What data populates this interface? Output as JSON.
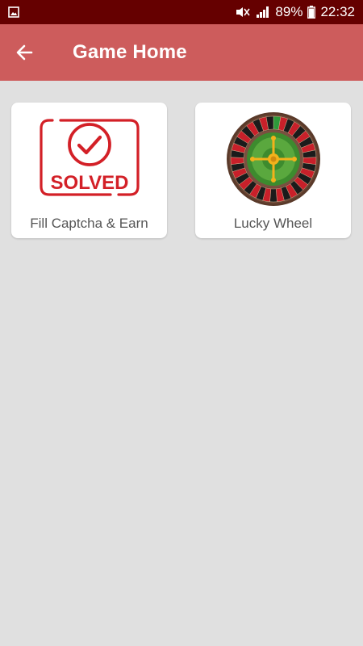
{
  "status_bar": {
    "battery": "89%",
    "time": "22:32",
    "icons": [
      "gallery-icon",
      "mute-icon",
      "signal-icon",
      "battery-icon"
    ]
  },
  "app_bar": {
    "title": "Game Home",
    "back_icon": "arrow-left-icon"
  },
  "games": [
    {
      "label": "Fill Captcha & Earn",
      "badge_text": "SOLVED",
      "icon": "captcha-solved-icon"
    },
    {
      "label": "Lucky Wheel",
      "icon": "roulette-wheel-icon"
    }
  ],
  "colors": {
    "status_bar": "#650000",
    "app_bar": "#cd5c5c",
    "background": "#e0e0e0",
    "card": "#ffffff",
    "accent_red": "#d32027"
  }
}
